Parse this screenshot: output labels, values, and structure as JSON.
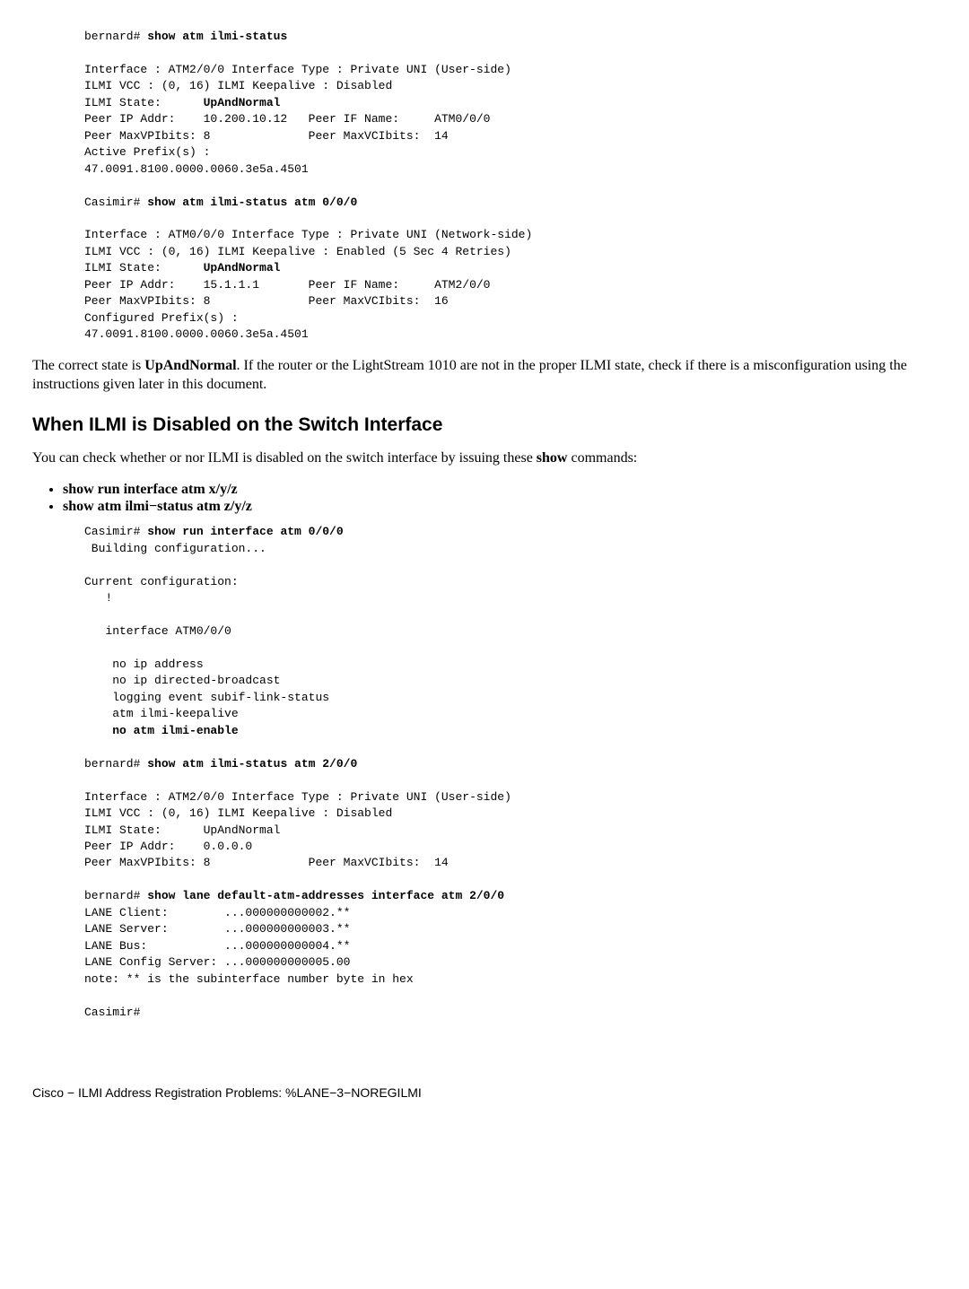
{
  "block1": {
    "prompt": "bernard# ",
    "cmd": "show atm ilmi-status",
    "l1": "Interface : ATM2/0/0 Interface Type : Private UNI (User-side)",
    "l2": "ILMI VCC : (0, 16) ILMI Keepalive : Disabled",
    "l3a": "ILMI State:      ",
    "l3b": "UpAndNormal",
    "l4": "Peer IP Addr:    10.200.10.12   Peer IF Name:     ATM0/0/0",
    "l5": "Peer MaxVPIbits: 8              Peer MaxVCIbits:  14",
    "l6": "Active Prefix(s) :",
    "l7": "47.0091.8100.0000.0060.3e5a.4501"
  },
  "block2": {
    "prompt": "Casimir# ",
    "cmd": "show atm ilmi-status atm 0/0/0",
    "l1": "Interface : ATM0/0/0 Interface Type : Private UNI (Network-side)",
    "l2": "ILMI VCC : (0, 16) ILMI Keepalive : Enabled (5 Sec 4 Retries)",
    "l3a": "ILMI State:      ",
    "l3b": "UpAndNormal",
    "l4": "Peer IP Addr:    15.1.1.1       Peer IF Name:     ATM2/0/0",
    "l5": "Peer MaxVPIbits: 8              Peer MaxVCIbits:  16",
    "l6": "Configured Prefix(s) :",
    "l7": "47.0091.8100.0000.0060.3e5a.4501"
  },
  "para1a": "The correct state is ",
  "para1b": "UpAndNormal",
  "para1c": ". If the router or the LightStream 1010 are not in the proper ILMI state, check if there is a misconfiguration using the instructions given later in this document.",
  "heading": "When ILMI is Disabled on the Switch Interface",
  "para2a": "You can check whether or nor ILMI is disabled on the switch interface by issuing these ",
  "para2b": "show",
  "para2c": " commands:",
  "bullet1": "show run interface atm x/y/z",
  "bullet2": "show atm ilmi−status atm z/y/z",
  "block3": {
    "p1": "Casimir# ",
    "c1": "show run interface atm 0/0/0",
    "l1": " Building configuration...",
    "l2": "Current configuration:",
    "l3": "   !",
    "l4": "   interface ATM0/0/0",
    "l5": "    no ip address",
    "l6": "    no ip directed-broadcast",
    "l7": "    logging event subif-link-status",
    "l8": "    atm ilmi-keepalive",
    "l9a": "    ",
    "l9b": "no atm ilmi-enable"
  },
  "block4": {
    "p1": "bernard# ",
    "c1": "show atm ilmi-status atm 2/0/0",
    "l1": "Interface : ATM2/0/0 Interface Type : Private UNI (User-side)",
    "l2": "ILMI VCC : (0, 16) ILMI Keepalive : Disabled",
    "l3": "ILMI State:      UpAndNormal",
    "l4": "Peer IP Addr:    0.0.0.0",
    "l5": "Peer MaxVPIbits: 8              Peer MaxVCIbits:  14"
  },
  "block5": {
    "p1": "bernard# ",
    "c1": "show lane default-atm-addresses interface atm 2/0/0",
    "l1": "LANE Client:        ...000000000002.**",
    "l2": "LANE Server:        ...000000000003.**",
    "l3": "LANE Bus:           ...000000000004.**",
    "l4": "LANE Config Server: ...000000000005.00",
    "l5": "note: ** is the subinterface number byte in hex",
    "l6": "Casimir#"
  },
  "footer": "Cisco − ILMI Address Registration Problems: %LANE−3−NOREGILMI"
}
